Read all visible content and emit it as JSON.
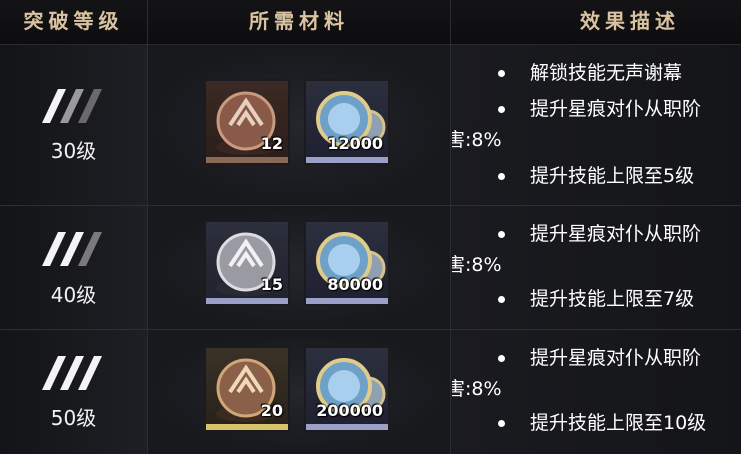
{
  "header": {
    "level": "突破等级",
    "materials": "所需材料",
    "effect": "效果描述"
  },
  "rows": [
    {
      "level": "30级",
      "items": [
        {
          "tier": "bronze",
          "qty": "12",
          "icon": "shield-ore-icon"
        },
        {
          "tier": "coin",
          "qty": "12000",
          "icon": "coin-stack-icon"
        }
      ],
      "effects": [
        "解锁技能无声谢幕",
        "提升星痕对仆从职阶",
        "害:8%",
        "提升技能上限至5级"
      ]
    },
    {
      "level": "40级",
      "items": [
        {
          "tier": "silver",
          "qty": "15",
          "icon": "shield-ore-icon"
        },
        {
          "tier": "coin",
          "qty": "80000",
          "icon": "coin-stack-icon"
        }
      ],
      "effects": [
        "提升星痕对仆从职阶",
        "害:8%",
        "提升技能上限至7级"
      ]
    },
    {
      "level": "50级",
      "items": [
        {
          "tier": "gold",
          "qty": "20",
          "icon": "shield-ore-icon"
        },
        {
          "tier": "coin",
          "qty": "200000",
          "icon": "coin-stack-icon"
        }
      ],
      "effects": [
        "提升星痕对仆从职阶",
        "害:8%",
        "提升技能上限至10级"
      ]
    }
  ]
}
